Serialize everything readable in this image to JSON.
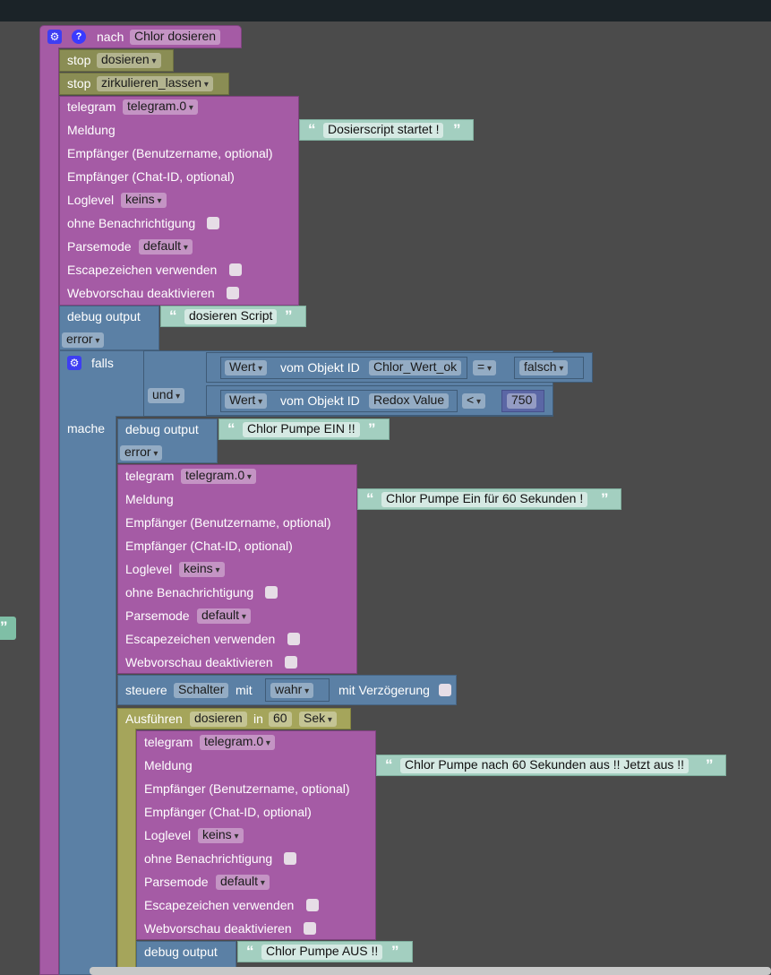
{
  "event": {
    "label": "nach",
    "value": "Chlor dosieren"
  },
  "stops": [
    {
      "label": "stop",
      "value": "dosieren"
    },
    {
      "label": "stop",
      "value": "zirkulieren_lassen"
    }
  ],
  "telegram_labels": {
    "telegram": "telegram",
    "instance": "telegram.0",
    "meldung": "Meldung",
    "empf_user": "Empfänger (Benutzername, optional)",
    "empf_chat": "Empfänger (Chat-ID, optional)",
    "loglevel": "Loglevel",
    "loglevel_val": "keins",
    "ohne": "ohne Benachrichtigung",
    "parsemode": "Parsemode",
    "parsemode_val": "default",
    "escape": "Escapezeichen verwenden",
    "webvorschau": "Webvorschau deaktivieren"
  },
  "telegram1": {
    "message": "Dosierscript startet !"
  },
  "debug1": {
    "label": "debug output",
    "text": "dosieren Script",
    "level": "error"
  },
  "if_block": {
    "falls": "falls",
    "und": "und",
    "mache": "mache",
    "cond1": {
      "prop": "Wert",
      "mid": "vom Objekt ID",
      "id": "Chlor_Wert_ok",
      "op": "=",
      "value": "falsch"
    },
    "cond2": {
      "prop": "Wert",
      "mid": "vom Objekt ID",
      "id": "Redox Value",
      "op": "<",
      "value": "750"
    }
  },
  "debug2": {
    "label": "debug output",
    "text": "Chlor Pumpe EIN !!",
    "level": "error"
  },
  "telegram2": {
    "message": "Chlor Pumpe Ein für 60 Sekunden !"
  },
  "control": {
    "label": "steuere",
    "target": "Schalter",
    "mit": "mit",
    "value": "wahr",
    "delay": "mit Verzögerung"
  },
  "timeout": {
    "label": "Ausführen",
    "name": "dosieren",
    "in": "in",
    "value": "60",
    "unit": "Sek"
  },
  "telegram3": {
    "message": "Chlor Pumpe nach 60 Sekunden aus !! Jetzt aus !!"
  },
  "debug3": {
    "label": "debug output",
    "text": "Chlor Pumpe AUS !!"
  }
}
